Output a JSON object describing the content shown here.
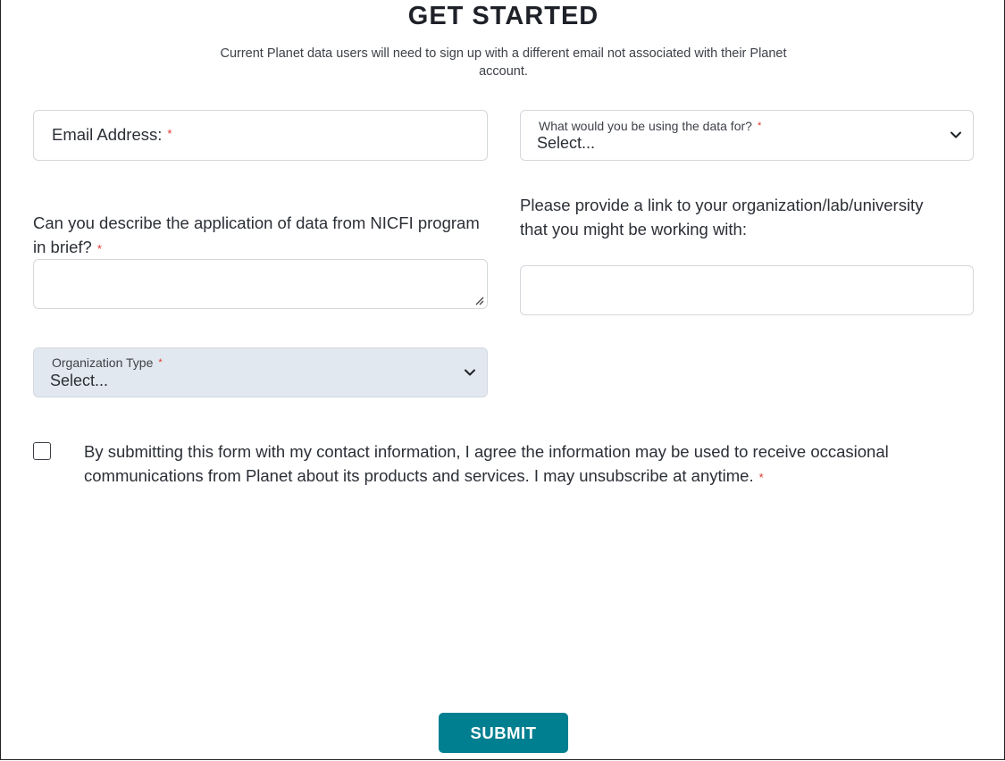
{
  "header": {
    "title": "GET STARTED",
    "subtitle": "Current Planet data users will need to sign up with a different email not associated with their Planet account."
  },
  "form": {
    "email": {
      "label": "Email Address:",
      "required": "*",
      "value": ""
    },
    "usage": {
      "label": "What would you be using the data for?",
      "required": "*",
      "selected": "Select..."
    },
    "application": {
      "label": "Can you describe the application of data from NICFI program in brief?",
      "required": "*",
      "value": ""
    },
    "org_link": {
      "label": "Please provide a link to your organization/lab/university that you might be working with:",
      "value": ""
    },
    "org_type": {
      "label": "Organization Type",
      "required": "*",
      "selected": "Select..."
    },
    "consent": {
      "text": "By submitting this form with my contact information, I agree the information may be used to receive occasional communications from Planet about its products and services. I may unsubscribe at anytime.",
      "required": "*",
      "checked": false
    },
    "submit_label": "SUBMIT"
  },
  "icons": {
    "chevron": "chevron-down-icon",
    "resize": "resize-grip-icon",
    "checkbox": "checkbox-icon"
  },
  "colors": {
    "accent": "#007f90",
    "required": "#e0342b",
    "select_grey": "#e2e8f0"
  }
}
